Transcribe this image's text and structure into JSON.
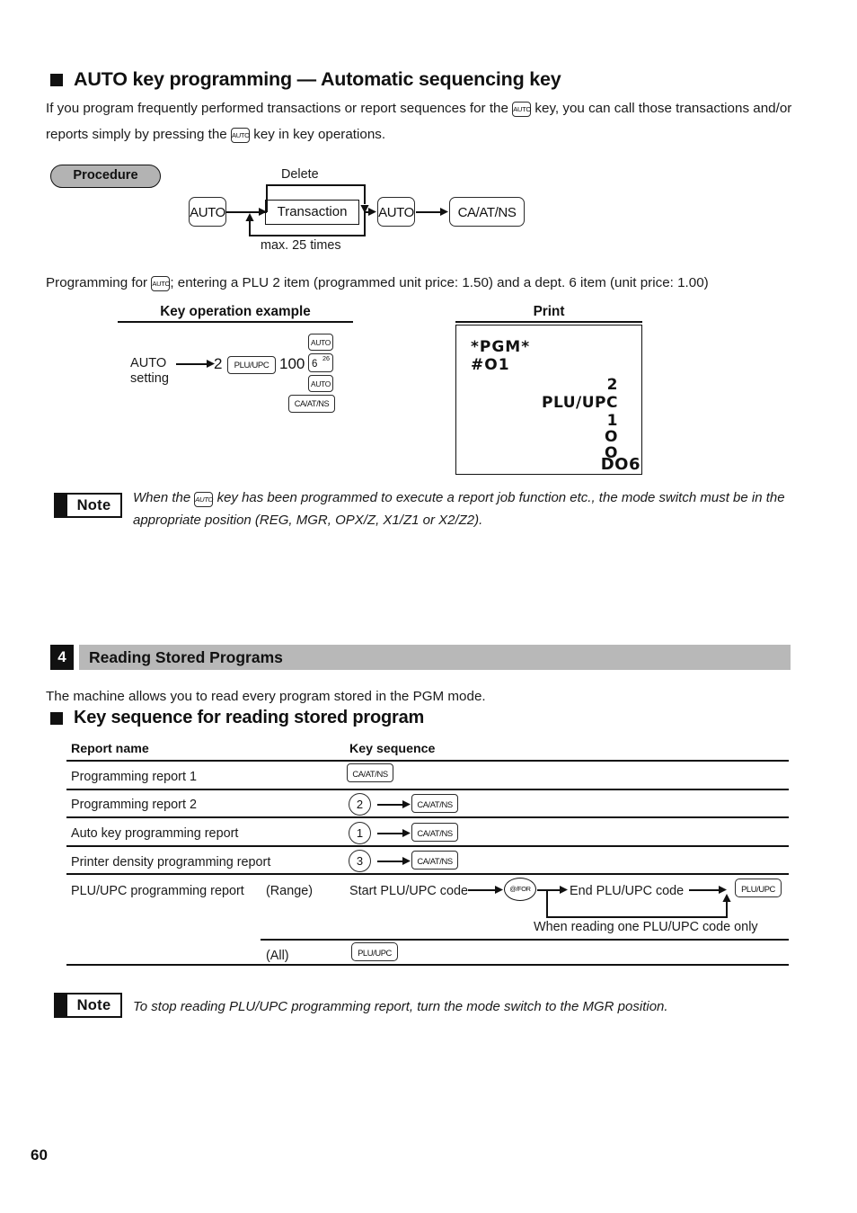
{
  "page": {
    "number": "60"
  },
  "section_auto": {
    "heading": "AUTO key programming — Automatic sequencing key",
    "intro_part1": "If you program frequently performed transactions or report sequences for the",
    "intro_part2": "key, you can call those transactions and/or reports simply by pressing the",
    "intro_part3": "key in key operations.",
    "procedure_label": "Procedure",
    "diagram": {
      "key_auto_1": "AUTO",
      "transaction_box": "Transaction",
      "key_auto_2": "AUTO",
      "key_ca": "CA/AT/NS",
      "label_delete": "Delete",
      "label_max": "max. 25 times"
    },
    "program_line_part1": "Programming for",
    "program_line_part2": "; entering a PLU 2 item (programmed unit price: 1.50) and a dept. 6 item (unit price: 1.00)",
    "caption_key_operation": "Key operation example",
    "caption_print": "Print",
    "key_operation": {
      "auto_label_line1": "AUTO",
      "auto_label_line2": "setting",
      "plu_number": "2",
      "key_plu": "PLU/UPC",
      "amount": "100",
      "key_auto_top": "AUTO",
      "key_dept_num": "6",
      "key_dept_sup": "26",
      "key_auto_bottom": "AUTO",
      "key_ca": "CA/AT/NS"
    },
    "receipt": {
      "line_pgm": "*PGM*",
      "line_id": "#O1",
      "right_lines": [
        "2",
        "PLU/UPC",
        "1",
        "O",
        "O"
      ],
      "dept_line": "DO6"
    },
    "note_label": "Note",
    "note_text_part1": "When the",
    "note_text_part2": "key has been programmed to execute a report job function etc., the mode switch must be in the appropriate position (REG, MGR, OPX/Z, X1/Z1 or X2/Z2)."
  },
  "section_reading": {
    "number": "4",
    "title": "Reading Stored Programs",
    "intro": "The machine allows you to read every program stored in the PGM mode.",
    "subheading": "Key sequence for reading stored program",
    "table": {
      "headers": [
        "Report name",
        "Key sequence"
      ],
      "rows": [
        {
          "name": "Programming report 1",
          "keys": [
            "CA/AT/NS"
          ]
        },
        {
          "name": "Programming report 2",
          "num": "2",
          "keys": [
            "CA/AT/NS"
          ]
        },
        {
          "name": "Auto key programming report",
          "num": "1",
          "keys": [
            "CA/AT/NS"
          ]
        },
        {
          "name": "Printer density programming report",
          "num": "3",
          "keys": [
            "CA/AT/NS"
          ]
        }
      ],
      "plu_row": {
        "name": "PLU/UPC programming report",
        "range_label": "(Range)",
        "start_label": "Start PLU/UPC code",
        "at_for_key": "@/FOR",
        "end_label": "End PLU/UPC code",
        "plu_key": "PLU/UPC",
        "single_note": "When reading one PLU/UPC code only",
        "all_label": "(All)",
        "all_key": "PLU/UPC"
      }
    },
    "note_label": "Note",
    "note_text": "To stop reading PLU/UPC programming report, turn the mode switch to the MGR position."
  }
}
